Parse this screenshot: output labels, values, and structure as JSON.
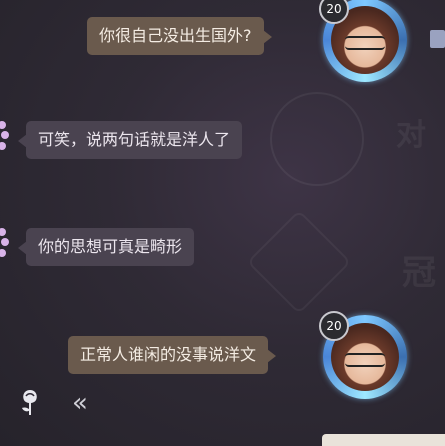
{
  "messages": [
    {
      "side": "right",
      "text": "你很自己没出生国外?",
      "level": "20"
    },
    {
      "side": "left",
      "text": "可笑，说两句话就是洋人了"
    },
    {
      "side": "left",
      "text": "你的思想可真是畸形"
    },
    {
      "side": "right",
      "text": "正常人谁闲的没事说洋文",
      "level": "20"
    }
  ],
  "watermarks": {
    "text1": "对",
    "text2": "冠"
  },
  "colors": {
    "right_bubble": "#6a5a4d",
    "left_bubble": "#4a4350",
    "background": "#2f2a35"
  },
  "icons": {
    "bottom_left": "rose-icon",
    "collapse": "double-chevron-left-icon"
  },
  "collapse_label": "«"
}
